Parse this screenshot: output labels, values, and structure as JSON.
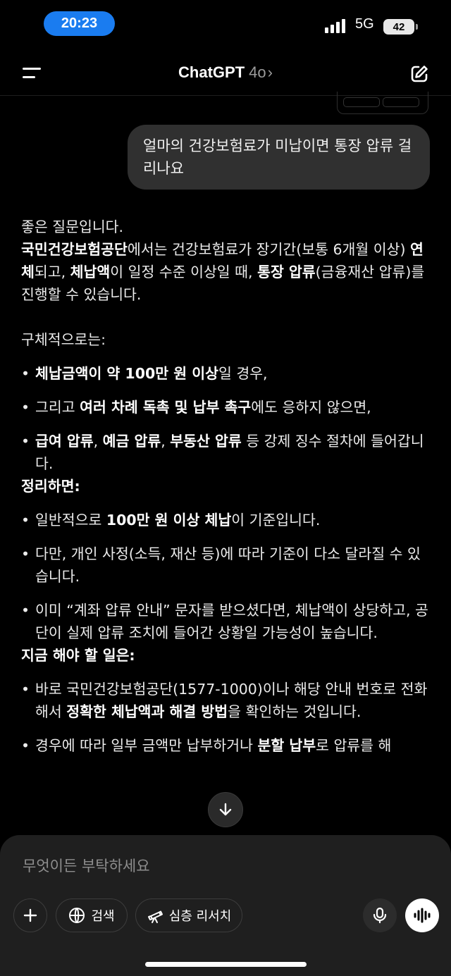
{
  "status_bar": {
    "time": "20:23",
    "network": "5G",
    "battery": "42"
  },
  "header": {
    "title": "ChatGPT",
    "model": "4o",
    "chevron": "›"
  },
  "user_message": "얼마의 건강보험료가 미납이면 통장 압류 걸리나요",
  "answer": {
    "intro": "좋은 질문입니다.",
    "p1": {
      "b1": "국민건강보험공단",
      "t1": "에서는 건강보험료가 장기간(보통 6개월 이상) ",
      "b2": "연체",
      "t2": "되고, ",
      "b3": "체납액",
      "t3": "이 일정 수준 이상일 때, ",
      "b4": "통장 압류",
      "t4": "(금융재산 압류)를 진행할 수 있습니다."
    },
    "sub_heading": "구체적으로는:",
    "details": [
      {
        "b": "체납금액이 약 100만 원 이상",
        "t": "일 경우,"
      },
      {
        "t0": "그리고 ",
        "b": "여러 차례 독촉 및 납부 촉구",
        "t": "에도 응하지 않으면,"
      },
      {
        "b1": "급여 압류",
        "s1": ", ",
        "b2": "예금 압류",
        "s2": ", ",
        "b3": "부동산 압류",
        "t": " 등 강제 징수 절차에 들어갑니다."
      }
    ],
    "summary_heading": "정리하면:",
    "summary": [
      {
        "t0": "일반적으로 ",
        "b": "100만 원 이상 체납",
        "t": "이 기준입니다."
      },
      {
        "t": "다만, 개인 사정(소득, 재산 등)에 따라 기준이 다소 달라질 수 있습니다."
      },
      {
        "t": "이미 “계좌 압류 안내” 문자를 받으셨다면, 체납액이 상당하고, 공단이 실제 압류 조치에 들어간 상황일 가능성이 높습니다."
      }
    ],
    "todo_heading": "지금 해야 할 일은:",
    "todo": [
      {
        "t0": "바로 국민건강보험공단(1577-1000)이나 해당 안내 번호로 전화해서 ",
        "b": "정확한 체납액과 해결 방법",
        "t": "을 확인하는 것입니다."
      },
      {
        "t0": "경우에 따라 일부 금액만 납부하거나 ",
        "b": "분할 납부",
        "t": "로 압류를 해"
      }
    ]
  },
  "composer": {
    "placeholder": "무엇이든 부탁하세요",
    "search_label": "검색",
    "deep_research_label": "심층 리서치"
  }
}
